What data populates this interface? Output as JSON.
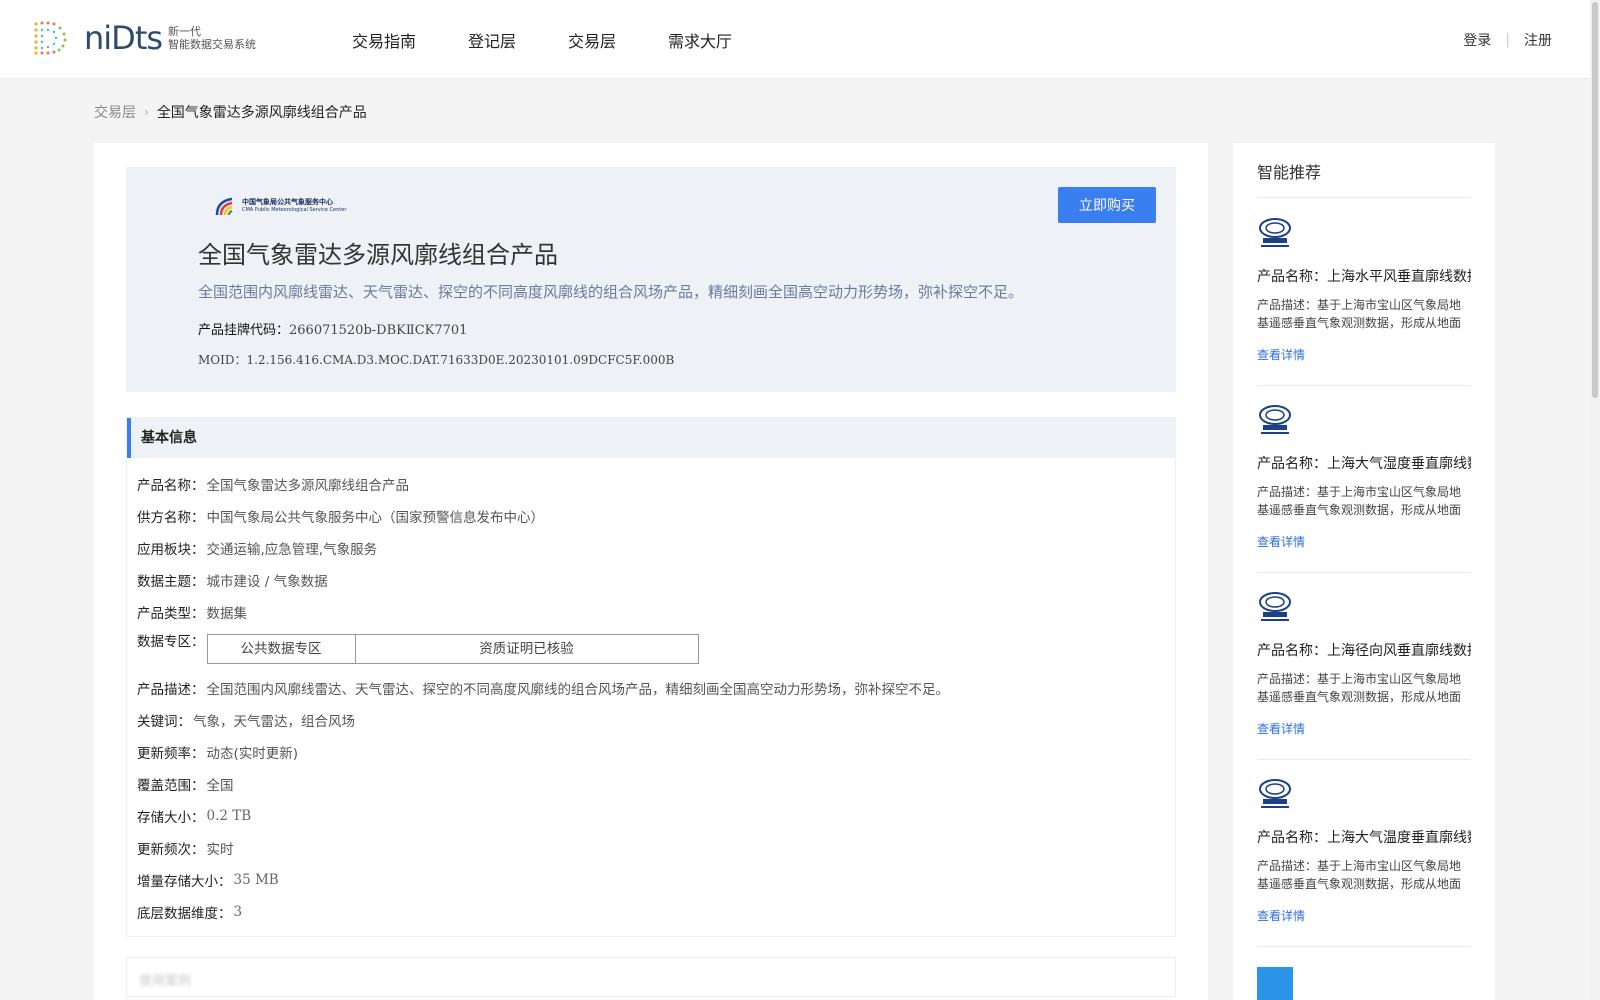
{
  "header": {
    "logo_word": "niDts",
    "logo_sub_1": "新一代",
    "logo_sub_2": "智能数据交易系统",
    "nav": [
      "交易指南",
      "登记层",
      "交易层",
      "需求大厅"
    ],
    "login": "登录",
    "separator": "|",
    "register": "注册"
  },
  "breadcrumb": {
    "parent": "交易层",
    "separator": "›",
    "current": "全国气象雷达多源风廓线组合产品"
  },
  "hero": {
    "org_line_1": "中国气象局公共气象服务中心",
    "org_line_2": "CMA Public Meteorological Service Center",
    "buy_label": "立即购买",
    "title": "全国气象雷达多源风廓线组合产品",
    "description": "全国范围内风廓线雷达、天气雷达、探空的不同高度风廓线的组合风场产品，精细刻画全国高空动力形势场，弥补探空不足。",
    "code_label": "产品挂牌代码：",
    "code_value": "266071520b-DBKⅡCK7701",
    "moid": "MOID：1.2.156.416.CMA.D3.MOC.DAT.71633D0E.20230101.09DCFC5F.000B"
  },
  "basic_info": {
    "heading": "基本信息",
    "rows": [
      {
        "label": "产品名称：",
        "value": "全国气象雷达多源风廓线组合产品"
      },
      {
        "label": "供方名称：",
        "value": "中国气象局公共气象服务中心（国家预警信息发布中心）"
      },
      {
        "label": "应用板块：",
        "value": "交通运输,应急管理,气象服务"
      },
      {
        "label": "数据主题：",
        "value": "城市建设 / 气象数据"
      },
      {
        "label": "产品类型：",
        "value": "数据集"
      },
      {
        "label": "数据专区：",
        "cells": [
          "公共数据专区",
          "资质证明已核验"
        ]
      },
      {
        "label": "产品描述：",
        "value": "全国范围内风廓线雷达、天气雷达、探空的不同高度风廓线的组合风场产品，精细刻画全国高空动力形势场，弥补探空不足。"
      },
      {
        "label": "关键词：",
        "value": "气象，天气雷达，组合风场"
      },
      {
        "label": "更新频率：",
        "value": "动态(实时更新)"
      },
      {
        "label": "覆盖范围：",
        "value": "全国"
      },
      {
        "label": "存储大小：",
        "value": "0.2 TB"
      },
      {
        "label": "更新频次：",
        "value": "实时"
      },
      {
        "label": "增量存储大小：",
        "value": "35 MB"
      },
      {
        "label": "底层数据维度：",
        "value": "3"
      }
    ]
  },
  "blurred_section": "使用案例",
  "sidebar": {
    "title": "智能推荐",
    "items": [
      {
        "name": "产品名称：上海水平风垂直廓线数据",
        "desc": "产品描述：基于上海市宝山区气象局地基遥感垂直气象观测数据，形成从地面到高空的垂直廓线",
        "link": "查看详情"
      },
      {
        "name": "产品名称：上海大气湿度垂直廓线数据",
        "desc": "产品描述：基于上海市宝山区气象局地基遥感垂直气象观测数据，形成从地面到高空的垂直廓线",
        "link": "查看详情"
      },
      {
        "name": "产品名称：上海径向风垂直廓线数据",
        "desc": "产品描述：基于上海市宝山区气象局地基遥感垂直气象观测数据，形成从地面到高空的垂直廓线",
        "link": "查看详情"
      },
      {
        "name": "产品名称：上海大气温度垂直廓线数据",
        "desc": "产品描述：基于上海市宝山区气象局地基遥感垂直气象观测数据，形成从地面到高空的垂直廓线",
        "link": "查看详情"
      }
    ]
  },
  "colors": {
    "accent": "#3a7ff0",
    "link": "#2f6fe0",
    "hero_bg": "#eef1f6",
    "page_bg": "#f4f4f4"
  },
  "icons": [
    "logo-dots-icon",
    "cma-logo-icon",
    "breadcrumb-chevron-icon",
    "product-thumbnail-icon"
  ]
}
